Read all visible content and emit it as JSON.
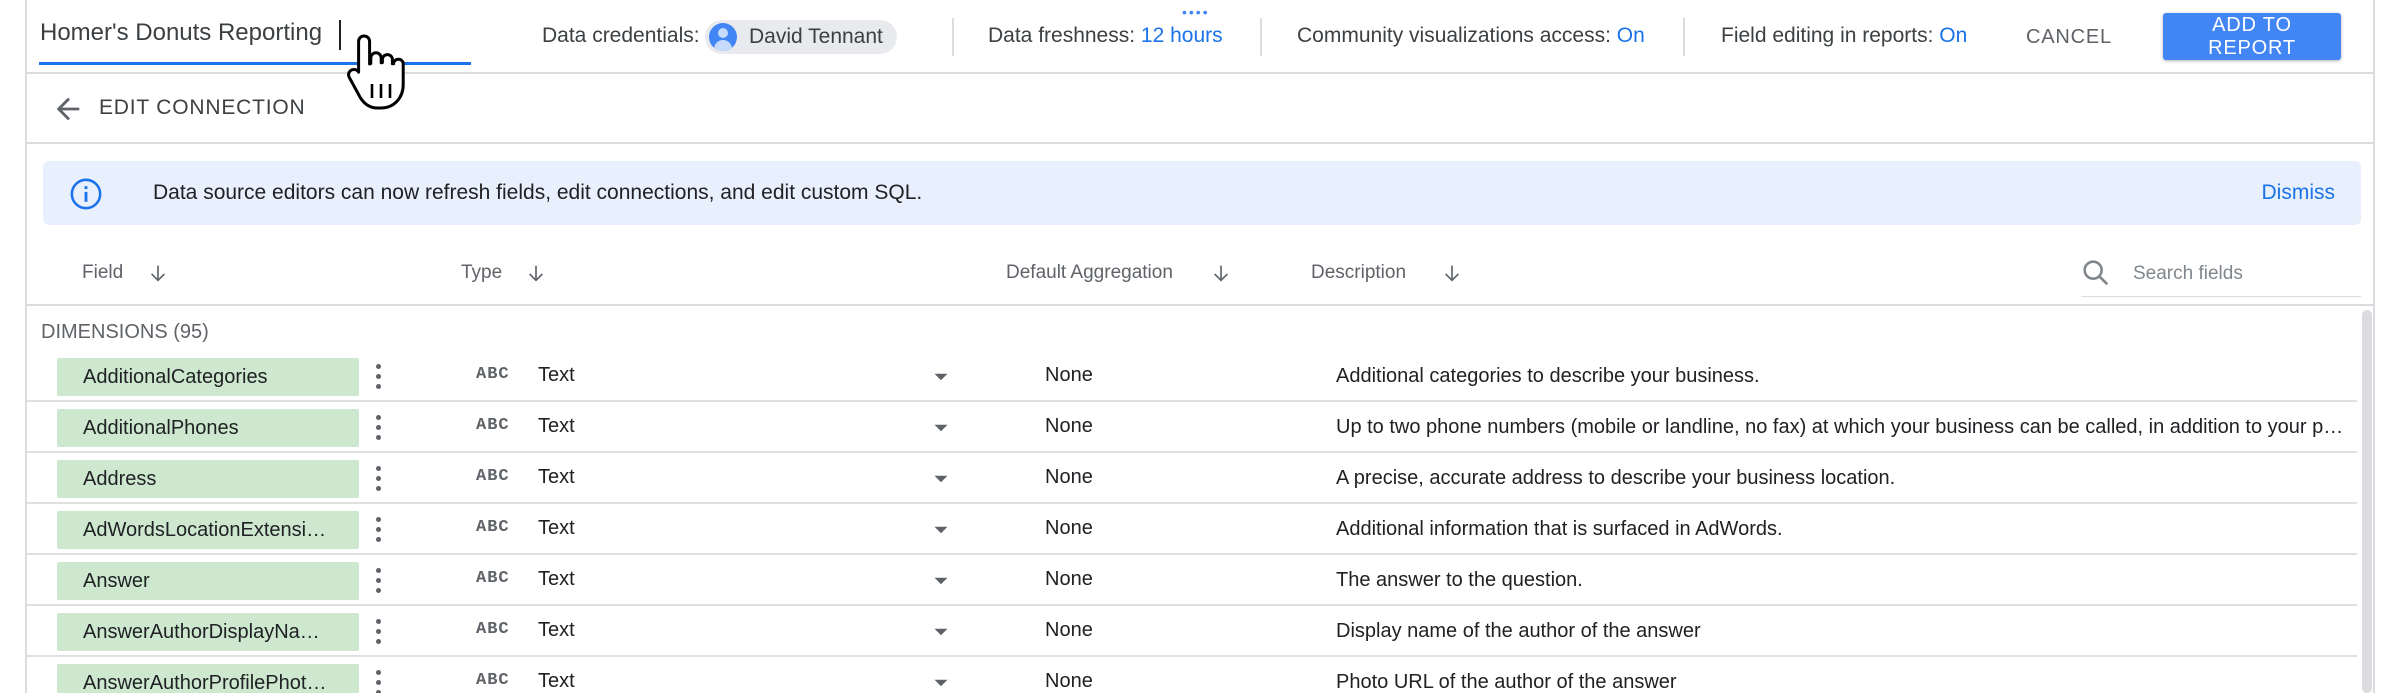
{
  "topbar": {
    "datasource_name": "Homer's Donuts Reporting",
    "credentials_label": "Data credentials:",
    "credentials_user": "David Tennant",
    "freshness_label": "Data freshness:",
    "freshness_value": "12 hours",
    "community_label": "Community visualizations access:",
    "community_value": "On",
    "field_editing_label": "Field editing in reports:",
    "field_editing_value": "On",
    "cancel_label": "CANCEL",
    "add_label": "ADD TO REPORT"
  },
  "edit_connection": {
    "label": "EDIT CONNECTION",
    "back_icon": "arrow-back-icon"
  },
  "banner": {
    "icon": "info-icon",
    "text": "Data source editors can now refresh fields, edit connections, and edit custom SQL.",
    "dismiss_label": "Dismiss"
  },
  "columns": {
    "field": "Field",
    "type": "Type",
    "default_aggregation": "Default Aggregation",
    "description": "Description",
    "search_placeholder": "Search fields"
  },
  "dimensions_label": "DIMENSIONS (95)",
  "rows": [
    {
      "field": "AdditionalCategories",
      "type_icon": "ABC",
      "type": "Text",
      "aggregation": "None",
      "description": "Additional categories to describe your business."
    },
    {
      "field": "AdditionalPhones",
      "type_icon": "ABC",
      "type": "Text",
      "aggregation": "None",
      "description": "Up to two phone numbers (mobile or landline, no fax) at which your business can be called, in addition to your prim…"
    },
    {
      "field": "Address",
      "type_icon": "ABC",
      "type": "Text",
      "aggregation": "None",
      "description": "A precise, accurate address to describe your business location."
    },
    {
      "field": "AdWordsLocationExtensi…",
      "type_icon": "ABC",
      "type": "Text",
      "aggregation": "None",
      "description": "Additional information that is surfaced in AdWords."
    },
    {
      "field": "Answer",
      "type_icon": "ABC",
      "type": "Text",
      "aggregation": "None",
      "description": "The answer to the question."
    },
    {
      "field": "AnswerAuthorDisplayNa…",
      "type_icon": "ABC",
      "type": "Text",
      "aggregation": "None",
      "description": "Display name of the author of the answer"
    },
    {
      "field": "AnswerAuthorProfilePhot…",
      "type_icon": "ABC",
      "type": "Text",
      "aggregation": "None",
      "description": "Photo URL of the author of the answer"
    }
  ],
  "colors": {
    "accent": "#1a73e8",
    "button_primary": "#4285f4",
    "banner_bg": "#e8f0fe",
    "dimension_pill": "#cde8cf"
  }
}
